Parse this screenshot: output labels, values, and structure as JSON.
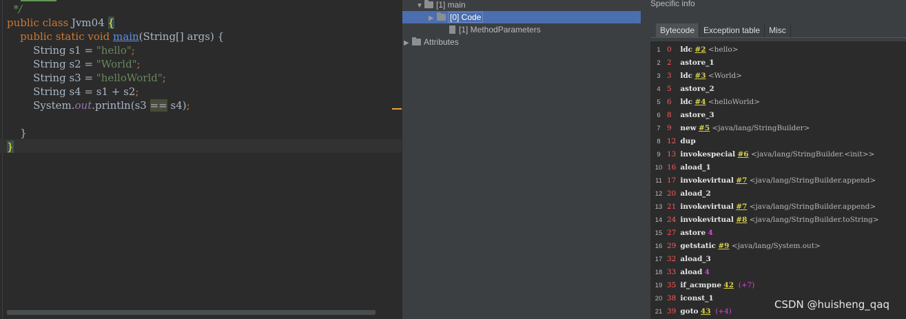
{
  "editor": {
    "lines": [
      {
        "parts": [
          {
            "t": "  "
          },
          {
            "t": "*/",
            "c": "cmt"
          }
        ]
      },
      {
        "parts": [
          {
            "t": "public class ",
            "c": "kw"
          },
          {
            "t": "Jvm04 "
          },
          {
            "t": "{",
            "c": "brace-hl"
          }
        ]
      },
      {
        "parts": [
          {
            "t": "    "
          },
          {
            "t": "public static void ",
            "c": "kw"
          },
          {
            "t": "main",
            "c": "fn"
          },
          {
            "t": "(String[] args) {"
          }
        ]
      },
      {
        "parts": [
          {
            "t": "        String s1 = "
          },
          {
            "t": "\"hello\"",
            "c": "str"
          },
          {
            "t": ";",
            "c": "kw"
          }
        ]
      },
      {
        "parts": [
          {
            "t": "        String s2 = "
          },
          {
            "t": "\"World\"",
            "c": "str"
          },
          {
            "t": ";",
            "c": "kw"
          }
        ]
      },
      {
        "parts": [
          {
            "t": "        String s3 = "
          },
          {
            "t": "\"helloWorld\"",
            "c": "str"
          },
          {
            "t": ";",
            "c": "kw"
          }
        ]
      },
      {
        "parts": [
          {
            "t": "        String s4 = s1 + s2"
          },
          {
            "t": ";",
            "c": "kw"
          }
        ]
      },
      {
        "parts": [
          {
            "t": "        System."
          },
          {
            "t": "out",
            "c": "fld"
          },
          {
            "t": ".println(s3 "
          },
          {
            "t": "==",
            "c": "op-hl"
          },
          {
            "t": " s4)"
          },
          {
            "t": ";",
            "c": "kw"
          }
        ]
      },
      {
        "parts": [
          {
            "t": ""
          }
        ]
      },
      {
        "parts": [
          {
            "t": "    }"
          }
        ]
      },
      {
        "parts": [
          {
            "t": "}",
            "c": "brace-hl"
          }
        ]
      }
    ]
  },
  "tree": {
    "items": [
      {
        "label": "[1] main",
        "arrow": "▼",
        "icon": "folder",
        "indent": 20,
        "selected": false
      },
      {
        "label": "[0] Code",
        "arrow": "▶",
        "icon": "folder",
        "indent": 38,
        "selected": true
      },
      {
        "label": "[1] MethodParameters",
        "arrow": "",
        "icon": "file",
        "indent": 56,
        "selected": false
      },
      {
        "label": "Attributes",
        "arrow": "▶",
        "icon": "folder",
        "indent": 2,
        "selected": false
      }
    ]
  },
  "panel": {
    "title": "Specific info",
    "tabs": [
      "Bytecode",
      "Exception table",
      "Misc"
    ],
    "active_tab": "Bytecode"
  },
  "bytecode": [
    {
      "ln": "1",
      "off": "0",
      "op": "ldc",
      "ref": "#2",
      "cm": "<hello>"
    },
    {
      "ln": "2",
      "off": "2",
      "op": "astore_1"
    },
    {
      "ln": "3",
      "off": "3",
      "op": "ldc",
      "ref": "#3",
      "cm": "<World>"
    },
    {
      "ln": "4",
      "off": "5",
      "op": "astore_2"
    },
    {
      "ln": "5",
      "off": "6",
      "op": "ldc",
      "ref": "#4",
      "cm": "<helloWorld>"
    },
    {
      "ln": "6",
      "off": "8",
      "op": "astore_3"
    },
    {
      "ln": "7",
      "off": "9",
      "op": "new",
      "ref": "#5",
      "cm": "<java/lang/StringBuilder>"
    },
    {
      "ln": "8",
      "off": "12",
      "op": "dup"
    },
    {
      "ln": "9",
      "off": "13",
      "op": "invokespecial",
      "ref": "#6",
      "cm": "<java/lang/StringBuilder.<init>>"
    },
    {
      "ln": "10",
      "off": "16",
      "op": "aload_1"
    },
    {
      "ln": "11",
      "off": "17",
      "op": "invokevirtual",
      "ref": "#7",
      "cm": "<java/lang/StringBuilder.append>"
    },
    {
      "ln": "12",
      "off": "20",
      "op": "aload_2"
    },
    {
      "ln": "13",
      "off": "21",
      "op": "invokevirtual",
      "ref": "#7",
      "cm": "<java/lang/StringBuilder.append>"
    },
    {
      "ln": "14",
      "off": "24",
      "op": "invokevirtual",
      "ref": "#8",
      "cm": "<java/lang/StringBuilder.toString>"
    },
    {
      "ln": "15",
      "off": "27",
      "op": "astore",
      "num": "4"
    },
    {
      "ln": "16",
      "off": "29",
      "op": "getstatic",
      "ref": "#9",
      "cm": "<java/lang/System.out>"
    },
    {
      "ln": "17",
      "off": "32",
      "op": "aload_3"
    },
    {
      "ln": "18",
      "off": "33",
      "op": "aload",
      "num": "4"
    },
    {
      "ln": "19",
      "off": "35",
      "op": "if_acmpne",
      "ref": "42",
      "rel": "(+7)"
    },
    {
      "ln": "20",
      "off": "38",
      "op": "iconst_1"
    },
    {
      "ln": "21",
      "off": "39",
      "op": "goto",
      "ref": "43",
      "rel": "(+4)"
    }
  ],
  "watermark": "CSDN @huisheng_qaq"
}
